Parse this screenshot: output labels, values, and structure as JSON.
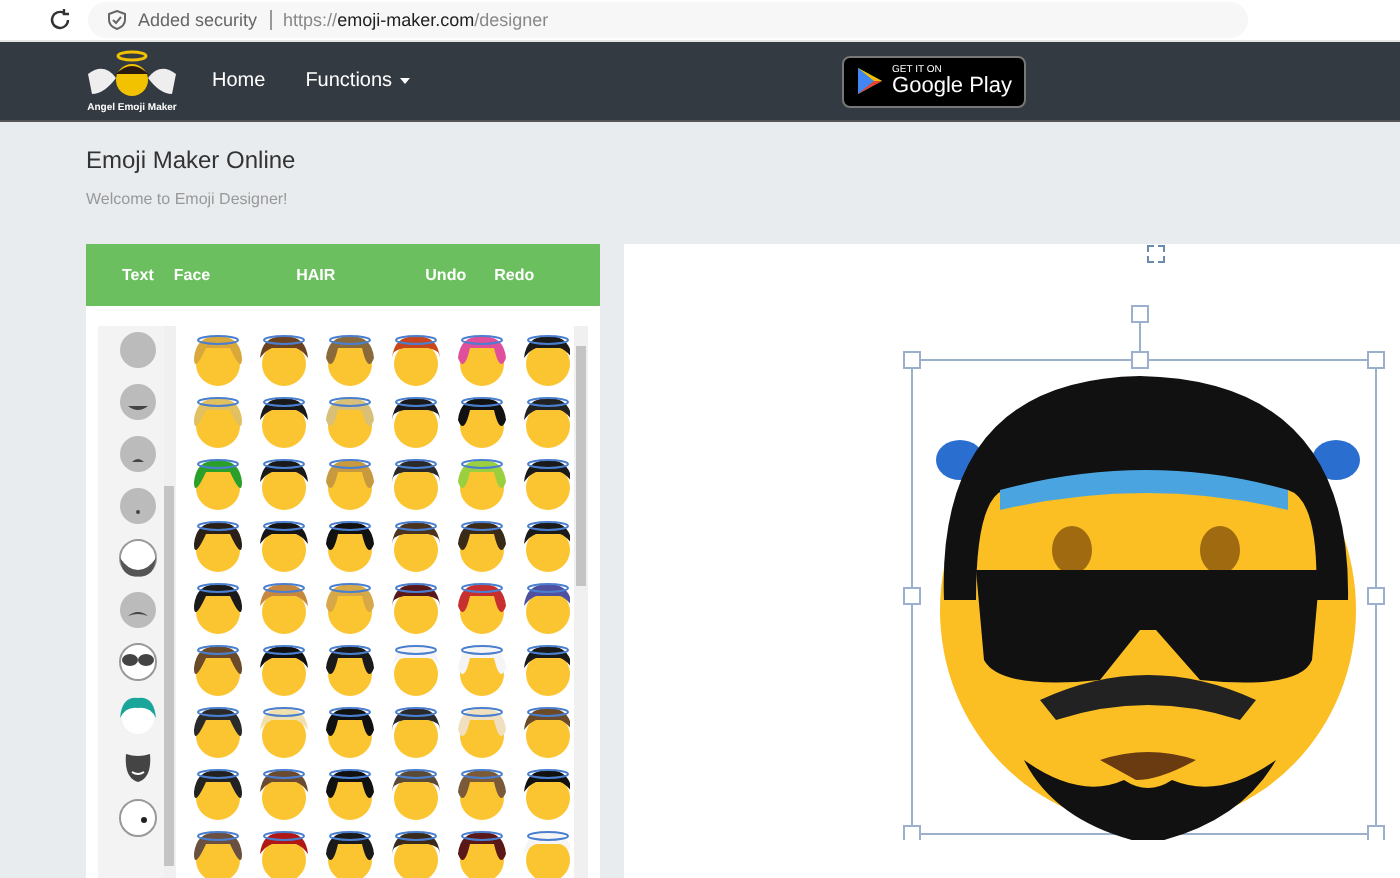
{
  "browser": {
    "security": "Added security",
    "url": "https://**emoji-maker.com**/designer"
  },
  "nav": {
    "logo_text": "Angel Emoji Maker",
    "links": [
      {
        "label": "Home",
        "kind": "link"
      },
      {
        "label": "Functions",
        "kind": "dropdown"
      }
    ],
    "store_badge": {
      "small": "GET IT ON",
      "large": "Google Play"
    }
  },
  "page": {
    "title": "Emoji Maker Online",
    "subtitle": "Welcome to Emoji Designer!"
  },
  "toolbar": [
    {
      "label": "Text"
    },
    {
      "label": "Face"
    },
    {
      "label": "HAIR"
    },
    {
      "label": "Undo"
    },
    {
      "label": "Redo"
    }
  ]
}
